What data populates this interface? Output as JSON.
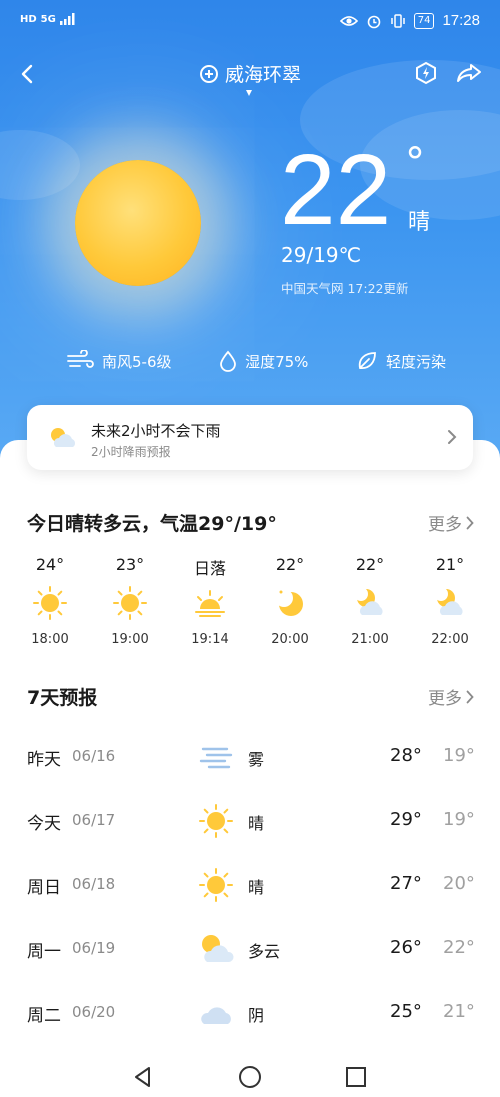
{
  "status": {
    "left_icons": [
      "HD",
      "5G",
      "signal"
    ],
    "battery": "74",
    "time": "17:28"
  },
  "header": {
    "city": "威海环翠"
  },
  "current": {
    "temp": "22",
    "degree_symbol": "°",
    "condition": "晴",
    "range": "29/19℃",
    "source": "中国天气网 17:22更新"
  },
  "metrics": {
    "wind": "南风5-6级",
    "humidity": "湿度75%",
    "air": "轻度污染"
  },
  "rain_card": {
    "title": "未来2小时不会下雨",
    "subtitle": "2小时降雨预报"
  },
  "today": {
    "title": "今日晴转多云，气温29°/19°",
    "more": "更多",
    "hours": [
      {
        "temp": "24°",
        "time": "18:00",
        "icon": "sun-icon"
      },
      {
        "temp": "23°",
        "time": "19:00",
        "icon": "sun-icon"
      },
      {
        "temp": "日落",
        "time": "19:14",
        "icon": "sunset-icon"
      },
      {
        "temp": "22°",
        "time": "20:00",
        "icon": "moon-icon"
      },
      {
        "temp": "22°",
        "time": "21:00",
        "icon": "moon-cloud-icon"
      },
      {
        "temp": "21°",
        "time": "22:00",
        "icon": "moon-cloud-icon"
      }
    ]
  },
  "forecast": {
    "title": "7天预报",
    "more": "更多",
    "days": [
      {
        "name": "昨天",
        "date": "06/16",
        "icon": "fog-icon",
        "cond": "雾",
        "hi": "28°",
        "lo": "19°"
      },
      {
        "name": "今天",
        "date": "06/17",
        "icon": "sun-icon",
        "cond": "晴",
        "hi": "29°",
        "lo": "19°"
      },
      {
        "name": "周日",
        "date": "06/18",
        "icon": "sun-icon",
        "cond": "晴",
        "hi": "27°",
        "lo": "20°"
      },
      {
        "name": "周一",
        "date": "06/19",
        "icon": "partly-cloudy-icon",
        "cond": "多云",
        "hi": "26°",
        "lo": "22°"
      },
      {
        "name": "周二",
        "date": "06/20",
        "icon": "cloud-icon",
        "cond": "阴",
        "hi": "25°",
        "lo": "21°"
      }
    ]
  },
  "colors": {
    "sky": "#3c95f0",
    "sun": "#ffc93a",
    "text_primary": "#1a1a1a",
    "text_secondary": "#8a8a8a"
  }
}
